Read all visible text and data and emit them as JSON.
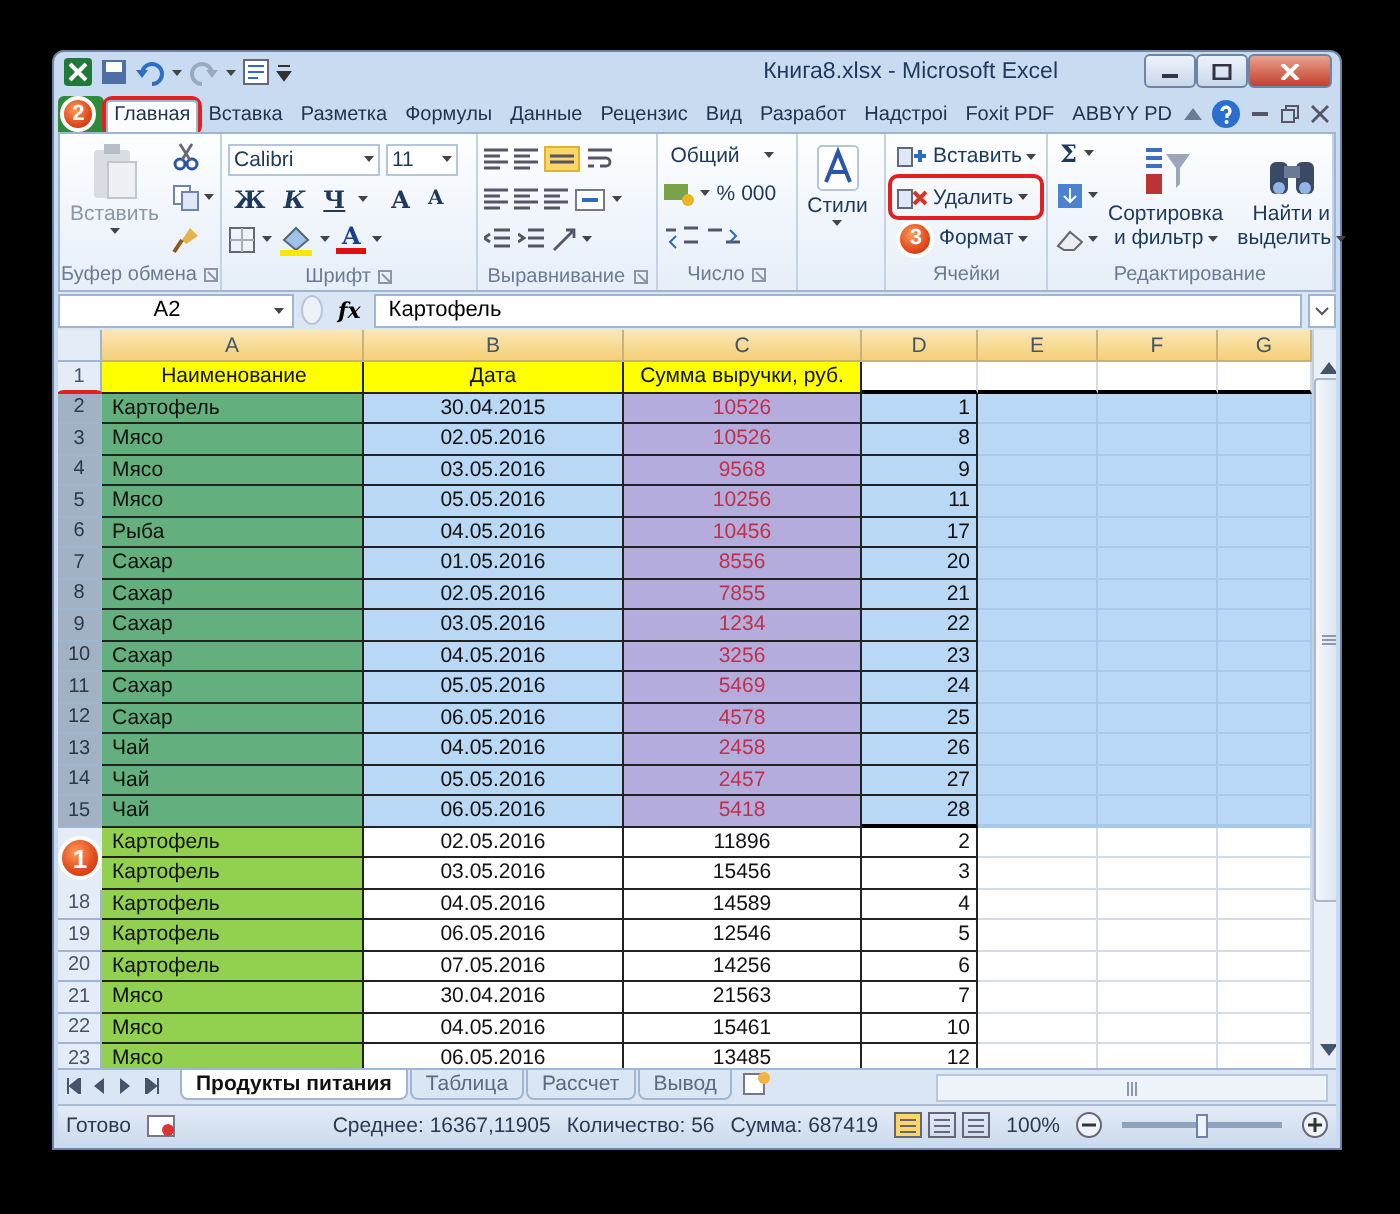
{
  "window": {
    "title": "Книга8.xlsx - Microsoft Excel"
  },
  "ribbon_tabs": [
    {
      "label": "Главная",
      "selected": true,
      "framed": true
    },
    {
      "label": "Вставка",
      "selected": false,
      "framed": false
    },
    {
      "label": "Разметка",
      "selected": false,
      "framed": false
    },
    {
      "label": "Формулы",
      "selected": false,
      "framed": false
    },
    {
      "label": "Данные",
      "selected": false,
      "framed": false
    },
    {
      "label": "Рецензис",
      "selected": false,
      "framed": false
    },
    {
      "label": "Вид",
      "selected": false,
      "framed": false
    },
    {
      "label": "Разработ",
      "selected": false,
      "framed": false
    },
    {
      "label": "Надстроі",
      "selected": false,
      "framed": false
    },
    {
      "label": "Foxit PDF",
      "selected": false,
      "framed": false
    },
    {
      "label": "ABBYY PD",
      "selected": false,
      "framed": false
    }
  ],
  "ribbon_groups": [
    {
      "kind": "clipboard",
      "label": "Буфер обмена",
      "paste": "Вставить"
    },
    {
      "kind": "font",
      "label": "Шрифт",
      "font_name": "Calibri",
      "font_size": "11",
      "bold": "Ж",
      "italic": "К",
      "underline": "Ч",
      "grow": "A",
      "shrink": "A",
      "font_color_button": "A"
    },
    {
      "kind": "alignment",
      "label": "Выравнивание"
    },
    {
      "kind": "number",
      "label": "Число",
      "format": "Общий",
      "percent": "%",
      "thousands": "000"
    },
    {
      "kind": "styles",
      "button": "Стили"
    },
    {
      "kind": "cells",
      "label": "Ячейки",
      "buttons": [
        {
          "label": "Вставить",
          "framed": false
        },
        {
          "label": "Удалить",
          "framed": true
        },
        {
          "label": "Формат",
          "framed": false
        }
      ]
    },
    {
      "kind": "editing",
      "label": "Редактирование",
      "sum": "Σ",
      "sort": [
        "Сортировка",
        "и фильтр"
      ],
      "find": [
        "Найти и",
        "выделить"
      ]
    }
  ],
  "formula_bar": {
    "cell": "A2",
    "fx": "fx",
    "value": "Картофель"
  },
  "sheet": {
    "columns": [
      "A",
      "B",
      "C",
      "D",
      "E",
      "F",
      "G"
    ],
    "rows": [
      {
        "kind": "header",
        "number": "1",
        "selected": false,
        "cells": [
          "Наименование",
          "Дата",
          "Сумма выручки, руб."
        ]
      },
      {
        "kind": "data",
        "number": "2",
        "selected": true,
        "cells": [
          "Картофель",
          "30.04.2015",
          "10526",
          "1"
        ]
      },
      {
        "kind": "data",
        "number": "3",
        "selected": true,
        "cells": [
          "Мясо",
          "02.05.2016",
          "10526",
          "8"
        ]
      },
      {
        "kind": "data",
        "number": "4",
        "selected": true,
        "cells": [
          "Мясо",
          "03.05.2016",
          "9568",
          "9"
        ]
      },
      {
        "kind": "data",
        "number": "5",
        "selected": true,
        "cells": [
          "Мясо",
          "05.05.2016",
          "10256",
          "11"
        ]
      },
      {
        "kind": "data",
        "number": "6",
        "selected": true,
        "cells": [
          "Рыба",
          "04.05.2016",
          "10456",
          "17"
        ]
      },
      {
        "kind": "data",
        "number": "7",
        "selected": true,
        "cells": [
          "Сахар",
          "01.05.2016",
          "8556",
          "20"
        ]
      },
      {
        "kind": "data",
        "number": "8",
        "selected": true,
        "cells": [
          "Сахар",
          "02.05.2016",
          "7855",
          "21"
        ]
      },
      {
        "kind": "data",
        "number": "9",
        "selected": true,
        "cells": [
          "Сахар",
          "03.05.2016",
          "1234",
          "22"
        ]
      },
      {
        "kind": "data",
        "number": "10",
        "selected": true,
        "cells": [
          "Сахар",
          "04.05.2016",
          "3256",
          "23"
        ]
      },
      {
        "kind": "data",
        "number": "11",
        "selected": true,
        "cells": [
          "Сахар",
          "05.05.2016",
          "5469",
          "24"
        ]
      },
      {
        "kind": "data",
        "number": "12",
        "selected": true,
        "cells": [
          "Сахар",
          "06.05.2016",
          "4578",
          "25"
        ]
      },
      {
        "kind": "data",
        "number": "13",
        "selected": true,
        "cells": [
          "Чай",
          "04.05.2016",
          "2458",
          "26"
        ]
      },
      {
        "kind": "data",
        "number": "14",
        "selected": true,
        "cells": [
          "Чай",
          "05.05.2016",
          "2457",
          "27"
        ]
      },
      {
        "kind": "data",
        "number": "15",
        "selected": true,
        "cells": [
          "Чай",
          "06.05.2016",
          "5418",
          "28"
        ]
      },
      {
        "kind": "data",
        "selected": false,
        "cells": [
          "Картофель",
          "02.05.2016",
          "11896",
          "2"
        ]
      },
      {
        "kind": "data",
        "selected": false,
        "cells": [
          "Картофель",
          "03.05.2016",
          "15456",
          "3"
        ]
      },
      {
        "kind": "data",
        "number": "18",
        "selected": false,
        "cells": [
          "Картофель",
          "04.05.2016",
          "14589",
          "4"
        ]
      },
      {
        "kind": "data",
        "number": "19",
        "selected": false,
        "cells": [
          "Картофель",
          "06.05.2016",
          "12546",
          "5"
        ]
      },
      {
        "kind": "data",
        "number": "20",
        "selected": false,
        "cells": [
          "Картофель",
          "07.05.2016",
          "14256",
          "6"
        ]
      },
      {
        "kind": "data",
        "number": "21",
        "selected": false,
        "cells": [
          "Мясо",
          "30.04.2016",
          "21563",
          "7"
        ]
      },
      {
        "kind": "data",
        "number": "22",
        "selected": false,
        "cells": [
          "Мясо",
          "04.05.2016",
          "15461",
          "10"
        ]
      },
      {
        "kind": "data",
        "number": "23",
        "selected": false,
        "cells": [
          "Мясо",
          "06.05.2016",
          "13485",
          "12"
        ]
      }
    ]
  },
  "sheet_tabs": [
    {
      "label": "Продукты питания",
      "selected": true
    },
    {
      "label": "Таблица",
      "selected": false
    },
    {
      "label": "Рассчет",
      "selected": false
    },
    {
      "label": "Вывод",
      "selected": false
    }
  ],
  "status_bar": {
    "state": "Готово",
    "average": "Среднее: 16367,11905",
    "count": "Количество: 56",
    "sum": "Сумма: 687419",
    "zoom": "100%",
    "zoom_slider": {
      "level": 0.5
    }
  },
  "callouts": [
    {
      "number": "1"
    },
    {
      "number": "2"
    },
    {
      "number": "3"
    }
  ]
}
